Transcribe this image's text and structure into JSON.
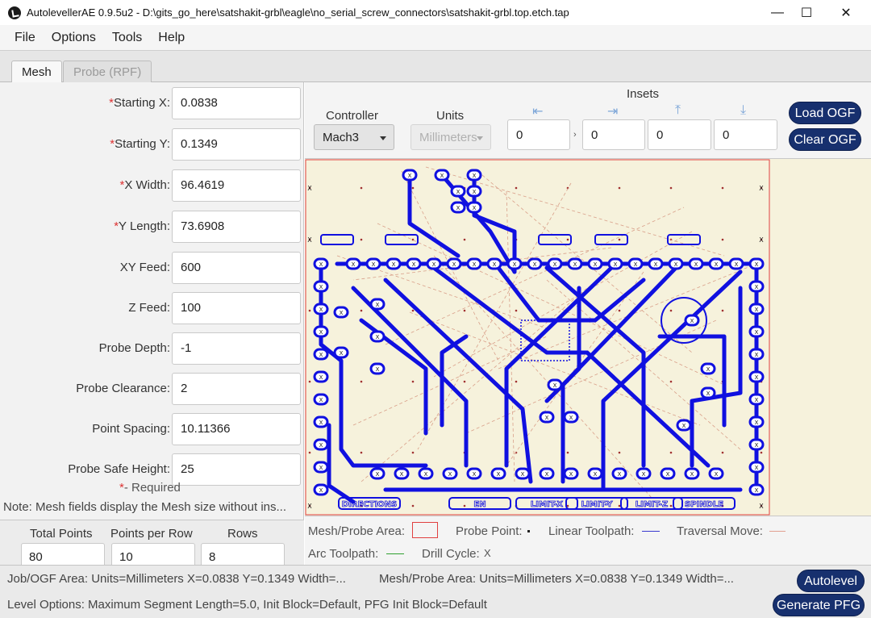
{
  "window": {
    "title": "AutolevellerAE 0.9.5u2 - D:\\gits_go_here\\satshakit-grbl\\eagle\\no_serial_screw_connectors\\satshakit-grbl.top.etch.tap",
    "minimize": "—",
    "maximize": "☐",
    "close": "✕"
  },
  "menu": [
    "File",
    "Options",
    "Tools",
    "Help"
  ],
  "tabs": [
    {
      "label": "Mesh",
      "active": true
    },
    {
      "label": "Probe (RPF)",
      "active": false
    }
  ],
  "mesh_fields": [
    {
      "req": "*",
      "label": "Starting X:",
      "value": "0.0838"
    },
    {
      "req": "*",
      "label": "Starting Y:",
      "value": "0.1349"
    },
    {
      "req": "*",
      "label": "X Width:",
      "value": "96.4619"
    },
    {
      "req": "*",
      "label": "Y Length:",
      "value": "73.6908"
    },
    {
      "req": "",
      "label": "XY Feed:",
      "value": "600"
    },
    {
      "req": "",
      "label": "Z Feed:",
      "value": "100"
    },
    {
      "req": "",
      "label": "Probe Depth:",
      "value": "-1"
    },
    {
      "req": "",
      "label": "Probe Clearance:",
      "value": "2"
    },
    {
      "req": "",
      "label": "Point Spacing:",
      "value": "10.11366"
    },
    {
      "req": "",
      "label": "Probe Safe Height:",
      "value": "25"
    }
  ],
  "required_note": "*- Required",
  "mesh_note": "Note: Mesh fields display the Mesh size without ins...",
  "points": {
    "total_label": "Total Points",
    "total_value": "80",
    "per_row_label": "Points per Row",
    "per_row_value": "10",
    "rows_label": "Rows",
    "rows_value": "8"
  },
  "controller": {
    "label": "Controller",
    "value": "Mach3"
  },
  "units": {
    "label": "Units",
    "value": "Millimeters"
  },
  "insets": {
    "label": "Insets",
    "arrows": [
      "⇤",
      "⇥",
      "⤒",
      "⤓"
    ],
    "values": [
      "0",
      "0",
      "0",
      "0"
    ]
  },
  "buttons": {
    "load_ogf": "Load OGF",
    "clear_ogf": "Clear OGF",
    "autolevel": "Autolevel",
    "generate_pfg": "Generate PFG"
  },
  "board_labels": [
    "DIRECTIONS",
    "EN",
    "LIMIT-X",
    "LIMIT-Y",
    "LIMIT-Z",
    "SPINDLE"
  ],
  "legend": {
    "mesh_probe_area": "Mesh/Probe Area:",
    "probe_point": "Probe Point:",
    "linear_toolpath": "Linear Toolpath:",
    "traversal_move": "Traversal Move:",
    "arc_toolpath": "Arc Toolpath:",
    "drill_cycle": "Drill Cycle:",
    "drill_symbol": "X"
  },
  "status": {
    "job_area": "Job/OGF Area: Units=Millimeters X=0.0838 Y=0.1349 Width=...",
    "mesh_area": "Mesh/Probe Area: Units=Millimeters X=0.0838 Y=0.1349 Width=...",
    "level_options": "Level Options: Maximum Segment Length=5.0, Init Block=Default, PFG Init Block=Default"
  },
  "colors": {
    "toolpath": "#1010e0",
    "traversal": "#d9a08a",
    "probe_area": "#e04040",
    "arc": "#30a030",
    "button": "#17306e",
    "pcb_bg": "#f6f2dc"
  }
}
